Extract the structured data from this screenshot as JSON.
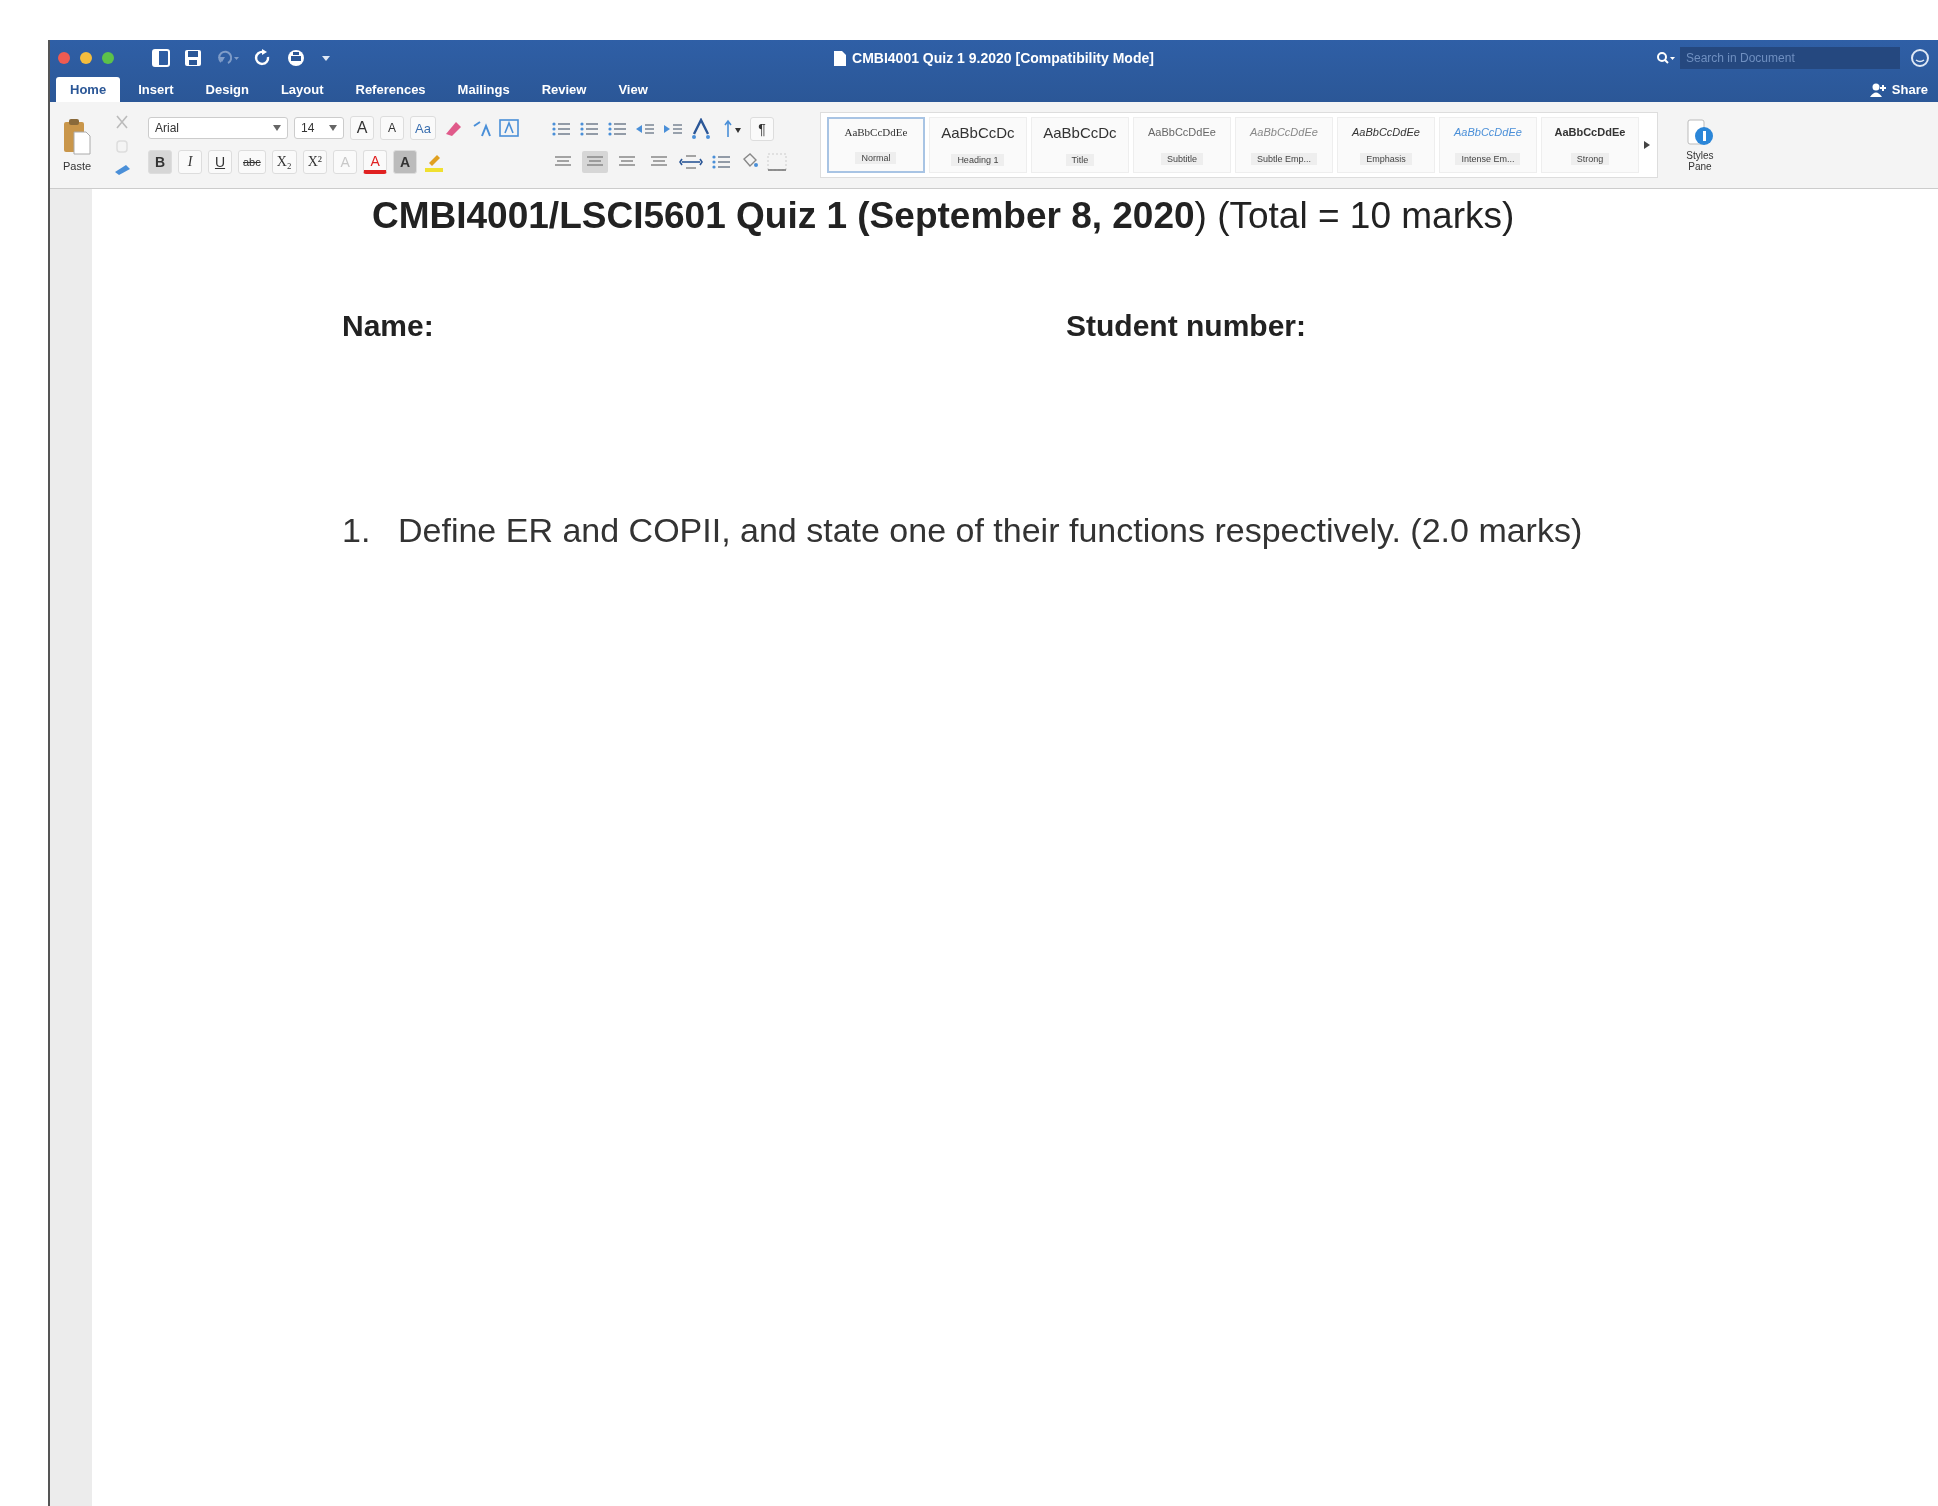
{
  "window": {
    "title": "CMBI4001 Quiz 1 9.2020 [Compatibility Mode]"
  },
  "tabs": [
    {
      "label": "Home",
      "selected": true
    },
    {
      "label": "Insert",
      "selected": false
    },
    {
      "label": "Design",
      "selected": false
    },
    {
      "label": "Layout",
      "selected": false
    },
    {
      "label": "References",
      "selected": false
    },
    {
      "label": "Mailings",
      "selected": false
    },
    {
      "label": "Review",
      "selected": false
    },
    {
      "label": "View",
      "selected": false
    }
  ],
  "search": {
    "placeholder": "Search in Document"
  },
  "share": "Share",
  "ribbon": {
    "paste_label": "Paste",
    "font": "Arial",
    "size": "14",
    "font_tools": [
      {
        "label": "A",
        "kind": "grow"
      },
      {
        "label": "A",
        "kind": "shrink"
      },
      {
        "label": "Aa",
        "kind": "case"
      }
    ],
    "format_buttons": [
      {
        "label": "B",
        "kind": "bold",
        "selected": true
      },
      {
        "label": "I",
        "kind": "italic",
        "selected": false
      },
      {
        "label": "U",
        "kind": "underline",
        "selected": false
      },
      {
        "label": "abc",
        "kind": "strike",
        "selected": false
      },
      {
        "label": "X₂",
        "kind": "sub",
        "selected": false
      },
      {
        "label": "X²",
        "kind": "super",
        "selected": false
      }
    ],
    "color_buttons": [
      {
        "label": "A",
        "kind": "effects"
      },
      {
        "label": "A",
        "kind": "font-color",
        "color": "#e02020"
      },
      {
        "label": "A",
        "kind": "shade"
      }
    ],
    "align_buttons": [
      {
        "selected": false
      },
      {
        "selected": true
      },
      {
        "selected": false
      },
      {
        "selected": false
      }
    ],
    "pilcrow": "¶",
    "styles": [
      {
        "preview": "AaBbCcDdEe",
        "label": "Normal",
        "kind": "normal",
        "selected": true
      },
      {
        "preview": "AaBbCcDc",
        "label": "Heading 1",
        "kind": "heading",
        "selected": false
      },
      {
        "preview": "AaBbCcDc",
        "label": "Title",
        "kind": "title",
        "selected": false
      },
      {
        "preview": "AaBbCcDdEe",
        "label": "Subtitle",
        "kind": "subtitle",
        "selected": false
      },
      {
        "preview": "AaBbCcDdEe",
        "label": "Subtle Emp...",
        "kind": "subtle",
        "selected": false
      },
      {
        "preview": "AaBbCcDdEe",
        "label": "Emphasis",
        "kind": "emphasis",
        "selected": false
      },
      {
        "preview": "AaBbCcDdEe",
        "label": "Intense Em...",
        "kind": "intense",
        "selected": false
      },
      {
        "preview": "AaBbCcDdEe",
        "label": "Strong",
        "kind": "strong",
        "selected": false
      }
    ],
    "styles_pane": "Styles Pane"
  },
  "document": {
    "title": "**CMBI4001/LSCI5601 Quiz 1 (September 8, 2020**) (Total = 10 marks)",
    "fields": [
      {
        "label": "Name:"
      },
      {
        "label": "Student number:"
      }
    ],
    "questions": [
      {
        "number": "1.",
        "text": "Define ER and COPII, and state one of their functions respectively. (2.0 marks)"
      }
    ]
  }
}
